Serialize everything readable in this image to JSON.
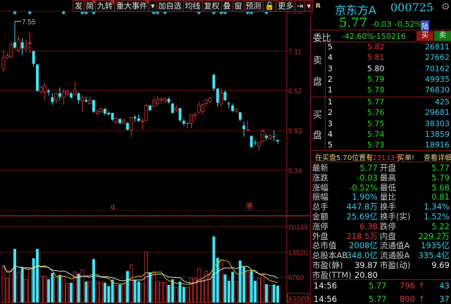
{
  "toolbar": {
    "items": [
      "发",
      "简",
      "九转",
      "重大事件",
      "▾",
      "加自选",
      "均线",
      "复权",
      "叠",
      "窗",
      "预测",
      "🔓",
      "更多",
      "⇥",
      "▾"
    ],
    "flagged": [
      1,
      2,
      3
    ]
  },
  "chart_data": {
    "type": "candlestick",
    "price_axis": {
      "ticks": [
        "7.70",
        "7.11",
        "6.52",
        "5.93",
        "5.34"
      ],
      "range": [
        5.1,
        7.7
      ]
    },
    "volume_axis": {
      "ticks": [
        "20139",
        "13520",
        "6760"
      ],
      "unit": "X1000"
    },
    "high_label": "7.55",
    "annotations": [
      {
        "text": "q",
        "index": 29
      },
      {
        "text": "港",
        "index": 65
      }
    ],
    "event_markers": [
      3,
      7,
      16,
      21,
      22,
      24,
      40,
      41,
      43,
      52,
      56,
      58,
      59,
      65,
      66,
      70
    ],
    "ohlc": [
      [
        6.84,
        7.01,
        7.11,
        6.8
      ],
      [
        7.01,
        7.04,
        7.08,
        6.99
      ],
      [
        7.02,
        7.2,
        7.24,
        7.01
      ],
      [
        7.24,
        7.16,
        7.55,
        7.14
      ],
      [
        7.12,
        7.28,
        7.33,
        7.1
      ],
      [
        7.24,
        7.15,
        7.3,
        7.05
      ],
      [
        7.14,
        7.17,
        7.28,
        7.1
      ],
      [
        7.22,
        7.23,
        7.38,
        7.08
      ],
      [
        7.11,
        6.92,
        7.11,
        6.88
      ],
      [
        6.91,
        6.52,
        6.91,
        6.5
      ],
      [
        6.5,
        6.57,
        6.6,
        6.48
      ],
      [
        6.5,
        6.59,
        6.64,
        6.38
      ],
      [
        6.52,
        6.5,
        6.55,
        6.45
      ],
      [
        6.42,
        6.35,
        6.48,
        6.31
      ],
      [
        6.38,
        6.48,
        6.49,
        6.33
      ],
      [
        6.48,
        6.43,
        6.57,
        6.38
      ],
      [
        6.42,
        6.5,
        6.55,
        6.31
      ],
      [
        6.47,
        6.51,
        6.54,
        6.45
      ],
      [
        6.48,
        6.42,
        6.5,
        6.4
      ],
      [
        6.47,
        6.53,
        6.66,
        6.45
      ],
      [
        6.48,
        6.38,
        6.5,
        6.33
      ],
      [
        6.37,
        6.42,
        6.45,
        6.21
      ],
      [
        6.38,
        6.36,
        6.43,
        6.34
      ],
      [
        6.33,
        6.38,
        6.43,
        6.31
      ],
      [
        6.38,
        6.21,
        6.39,
        6.19
      ],
      [
        6.18,
        6.22,
        6.24,
        6.16
      ],
      [
        6.21,
        6.25,
        6.26,
        6.19
      ],
      [
        6.25,
        6.18,
        6.26,
        6.16
      ],
      [
        6.19,
        6.17,
        6.21,
        6.15
      ],
      [
        6.19,
        6.09,
        6.19,
        6.07
      ],
      [
        6.05,
        6.11,
        6.13,
        6.04
      ],
      [
        6.1,
        6.04,
        6.11,
        6.02
      ],
      [
        6.04,
        6.07,
        6.11,
        6.02
      ],
      [
        6.04,
        5.94,
        6.05,
        5.93
      ],
      [
        5.94,
        6.12,
        6.13,
        5.83
      ],
      [
        6.13,
        6.11,
        6.16,
        6.06
      ],
      [
        6.11,
        6.07,
        6.17,
        6.06
      ],
      [
        6.06,
        6.07,
        6.11,
        5.95
      ],
      [
        6.08,
        6.3,
        6.33,
        6.08
      ],
      [
        6.3,
        6.23,
        6.31,
        6.22
      ],
      [
        6.29,
        6.37,
        6.42,
        6.28
      ],
      [
        6.33,
        6.39,
        6.44,
        6.3
      ],
      [
        6.38,
        6.4,
        6.42,
        6.32
      ],
      [
        6.37,
        6.4,
        6.42,
        6.33
      ],
      [
        6.4,
        6.35,
        6.42,
        6.33
      ],
      [
        6.33,
        6.19,
        6.34,
        6.18
      ],
      [
        6.23,
        6.26,
        6.31,
        6.2
      ],
      [
        6.26,
        6.08,
        6.26,
        6.06
      ],
      [
        6.07,
        6.03,
        6.1,
        6.0
      ],
      [
        6.03,
        6.04,
        6.05,
        5.96
      ],
      [
        6.04,
        6.16,
        6.17,
        5.96
      ],
      [
        6.15,
        6.18,
        6.19,
        6.1
      ],
      [
        6.2,
        6.3,
        6.36,
        6.19
      ],
      [
        6.21,
        6.31,
        6.33,
        6.18
      ],
      [
        6.33,
        6.38,
        6.4,
        6.3
      ],
      [
        6.36,
        6.41,
        6.43,
        6.34
      ],
      [
        6.76,
        6.55,
        6.76,
        6.52
      ],
      [
        6.55,
        6.34,
        6.56,
        6.28
      ],
      [
        6.32,
        6.49,
        6.56,
        6.3
      ],
      [
        6.5,
        6.38,
        6.53,
        6.36
      ],
      [
        6.33,
        6.32,
        6.36,
        6.26
      ],
      [
        6.3,
        6.22,
        6.33,
        6.2
      ],
      [
        6.21,
        6.24,
        6.26,
        6.19
      ],
      [
        6.2,
        6.09,
        6.2,
        6.06
      ],
      [
        6.0,
        5.95,
        6.06,
        5.84
      ],
      [
        5.93,
        5.94,
        6.07,
        5.93
      ],
      [
        5.85,
        5.68,
        5.85,
        5.68
      ],
      [
        5.75,
        5.74,
        5.79,
        5.71
      ],
      [
        5.7,
        5.75,
        5.76,
        5.63
      ],
      [
        5.77,
        5.92,
        5.95,
        5.75
      ],
      [
        5.85,
        5.82,
        5.88,
        5.78
      ],
      [
        5.81,
        5.85,
        5.87,
        5.79
      ],
      [
        5.84,
        5.83,
        5.93,
        5.77
      ],
      [
        5.79,
        5.77,
        5.79,
        5.73
      ]
    ],
    "volume": [
      9800,
      6400,
      8600,
      14300,
      8100,
      9300,
      6100,
      8900,
      11800,
      14300,
      7000,
      7000,
      6200,
      7900,
      6700,
      7400,
      7000,
      5100,
      5300,
      8200,
      7700,
      8700,
      5600,
      5600,
      11600,
      5600,
      5300,
      5300,
      4400,
      6100,
      4600,
      4800,
      4900,
      8400,
      10100,
      6100,
      5600,
      5100,
      13400,
      8100,
      8200,
      5600,
      5400,
      5300,
      4700,
      6200,
      4100,
      5600,
      4200,
      4100,
      6400,
      6400,
      9100,
      5900,
      8400,
      7600,
      17600,
      11900,
      11400,
      7500,
      5800,
      8200,
      5600,
      11200,
      9500,
      8100,
      8400,
      5800,
      6400,
      7300,
      4900,
      4600,
      4800,
      4500
    ],
    "volume_ma": [
      5,
      10
    ],
    "colors": {
      "up": "#e03535",
      "down": "#44e0f0",
      "ma5": "#d8c020",
      "ma10": "#e0e0e0",
      "grid": "#7a1515"
    }
  },
  "quote": {
    "badge": "R",
    "name": "京东方A",
    "code": "000725",
    "price": "5.77",
    "change": "-0.03",
    "change_pct": "-0.52%",
    "market": "陆",
    "weibi_label": "委比",
    "weibi_pct": "-42.60%",
    "weibi_diff": "-150216",
    "buy_btn": "买",
    "sell_btn": "卖"
  },
  "sell": {
    "label1": "卖",
    "label2": "盘",
    "rows": [
      {
        "lvl": "5",
        "price": "5.82",
        "vol": "26811",
        "cls": "r"
      },
      {
        "lvl": "4",
        "price": "5.81",
        "vol": "27662",
        "cls": "r"
      },
      {
        "lvl": "3",
        "price": "5.80",
        "vol": "70162",
        "cls": "w"
      },
      {
        "lvl": "2",
        "price": "5.79",
        "vol": "49935",
        "cls": "g"
      },
      {
        "lvl": "1",
        "price": "5.78",
        "vol": "76830",
        "cls": "g"
      }
    ]
  },
  "buy": {
    "label1": "买",
    "label2": "盘",
    "rows": [
      {
        "lvl": "1",
        "price": "5.77",
        "vol": "425",
        "cls": "g"
      },
      {
        "lvl": "2",
        "price": "5.76",
        "vol": "29681",
        "cls": "g"
      },
      {
        "lvl": "3",
        "price": "5.75",
        "vol": "38303",
        "cls": "g"
      },
      {
        "lvl": "4",
        "price": "5.74",
        "vol": "13859",
        "cls": "g"
      },
      {
        "lvl": "5",
        "price": "5.73",
        "vol": "18916",
        "cls": "g"
      }
    ]
  },
  "notice": {
    "prefix": "在买盘5.70位置有",
    "amount": "123133手",
    "suffix": "买单!",
    "link": "查看详细"
  },
  "stats": [
    {
      "l1": "最新",
      "v1": "5.77",
      "c1": "g",
      "l2": "开盘",
      "v2": "5.77",
      "c2": "g"
    },
    {
      "l1": "涨跌",
      "v1": "-0.03",
      "c1": "g",
      "l2": "最高",
      "v2": "5.79",
      "c2": "g"
    },
    {
      "l1": "涨幅",
      "v1": "-0.52%",
      "c1": "g",
      "l2": "最低",
      "v2": "5.68",
      "c2": "g"
    },
    {
      "l1": "振幅",
      "v1": "1.90%",
      "c1": "c",
      "l2": "量比",
      "v2": "0.81",
      "c2": "g"
    },
    {
      "l1": "总手",
      "v1": "447.8万",
      "c1": "c",
      "l2": "换手",
      "v2": "1.34%",
      "c2": "c"
    },
    {
      "l1": "金额",
      "v1": "25.69亿",
      "c1": "c",
      "l2": "换手(实)",
      "v2": "1.52%",
      "c2": "c"
    },
    {
      "l1": "涨停",
      "v1": "6.38",
      "c1": "r",
      "l2": "跌停",
      "v2": "5.22",
      "c2": "g"
    },
    {
      "l1": "外盘",
      "v1": "218.5万",
      "c1": "r",
      "l2": "内盘",
      "v2": "229.2万",
      "c2": "g"
    },
    {
      "l1": "总市值",
      "v1": "2008亿",
      "c1": "c",
      "l2": "流通值A",
      "v2": "1935亿",
      "c2": "c"
    },
    {
      "l1": "总股本AB",
      "v1": "348.0亿",
      "c1": "c",
      "l2": "流通股A",
      "v2": "335.4亿",
      "c2": "c"
    },
    {
      "l1": "市盈(静)",
      "v1": "39.87",
      "c1": "w",
      "l2": "市盈(动)",
      "v2": "9.69",
      "c2": "w"
    },
    {
      "l1": "市盈(TTM)",
      "v1": "20.80",
      "c1": "w",
      "l2": "",
      "v2": "",
      "c2": "w"
    }
  ],
  "ticks": [
    {
      "time": "14:56",
      "price": "5.77",
      "vol": "796",
      "arrow": "↑",
      "num": "43"
    },
    {
      "time": "14:56",
      "price": "5.77",
      "vol": "800",
      "arrow": "↑",
      "num": "37"
    }
  ]
}
